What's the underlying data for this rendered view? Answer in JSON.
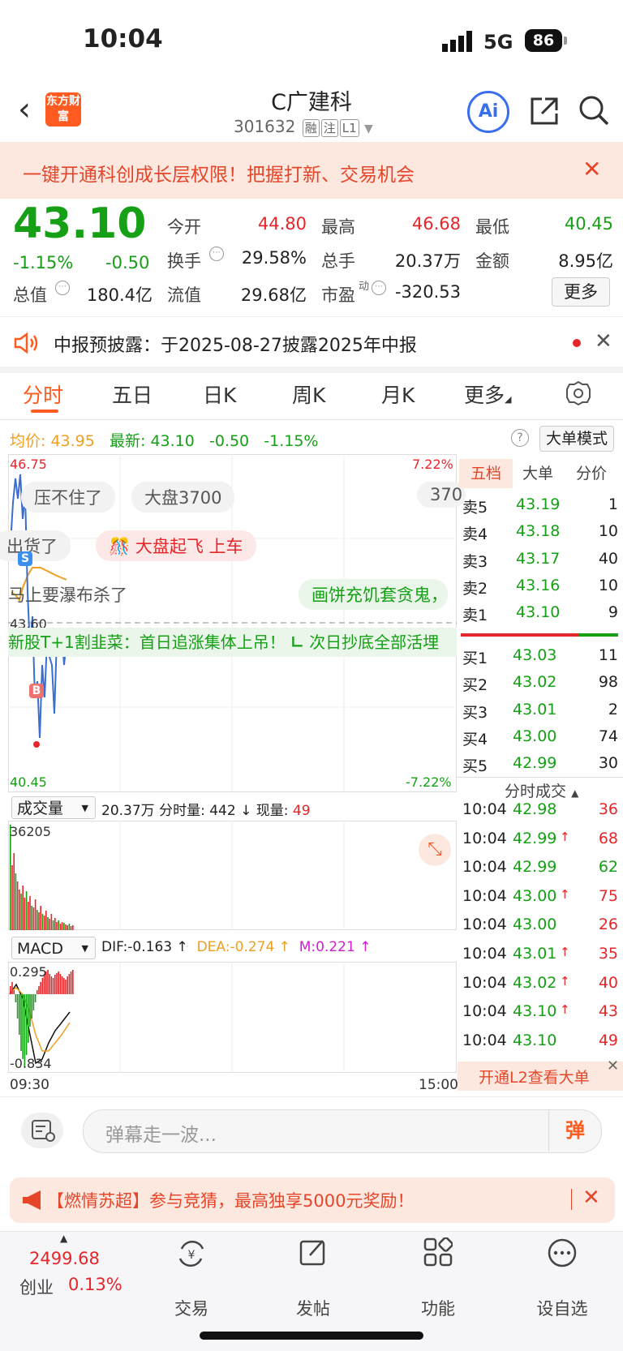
{
  "status": {
    "time": "10:04",
    "network": "5G",
    "battery": "86"
  },
  "header": {
    "title": "C广建科",
    "code": "301632",
    "tags": [
      "融",
      "注",
      "L1"
    ],
    "logo_text": "东方财富",
    "ai_label": "Ai"
  },
  "promo": {
    "text": "一键开通科创成长层权限！把握打新、交易机会"
  },
  "quote": {
    "price": "43.10",
    "pct": "-1.15%",
    "chg": "-0.50",
    "open_label": "今开",
    "open": "44.80",
    "high_label": "最高",
    "high": "46.68",
    "low_label": "最低",
    "low": "40.45",
    "turnover_label": "换手",
    "turnover": "29.58%",
    "volume_label": "总手",
    "volume": "20.37万",
    "amount_label": "金额",
    "amount": "8.95亿",
    "mktcap_label": "总值",
    "mktcap": "180.4亿",
    "float_label": "流值",
    "float": "29.68亿",
    "pe_label": "市盈",
    "pe_sup": "动",
    "pe": "-320.53",
    "more_label": "更多"
  },
  "notice": {
    "text": "中报预披露：于2025-08-27披露2025年中报"
  },
  "tabs": [
    "分时",
    "五日",
    "日K",
    "周K",
    "月K",
    "更多"
  ],
  "info": {
    "avg_label": "均价:",
    "avg": "43.95",
    "latest_label": "最新:",
    "latest": "43.10",
    "chg": "-0.50",
    "pct": "-1.15%",
    "big_mode": "大单模式"
  },
  "chart": {
    "y_max": "46.75",
    "y_min": "40.45",
    "pct_max": "7.22%",
    "pct_min": "-7.22%",
    "ref_price": "43.60",
    "time_start": "09:30",
    "time_end": "15:00",
    "bubbles": [
      "压不住了",
      "大盘3700",
      "370",
      "出货了",
      "大盘起飞 上车",
      "马上要瀑布杀了",
      "画饼充饥套贪鬼，",
      "新股T+1割韭菜：首日追涨集体上吊！",
      "次日抄底全部活埋"
    ],
    "markers": {
      "sell": "S",
      "buy": "B"
    }
  },
  "orderbook": {
    "tabs": [
      "五档",
      "大单",
      "分价"
    ],
    "asks": [
      {
        "label": "卖5",
        "price": "43.19",
        "vol": "1"
      },
      {
        "label": "卖4",
        "price": "43.18",
        "vol": "10"
      },
      {
        "label": "卖3",
        "price": "43.17",
        "vol": "40"
      },
      {
        "label": "卖2",
        "price": "43.16",
        "vol": "10"
      },
      {
        "label": "卖1",
        "price": "43.10",
        "vol": "9"
      }
    ],
    "bids": [
      {
        "label": "买1",
        "price": "43.03",
        "vol": "11"
      },
      {
        "label": "买2",
        "price": "43.02",
        "vol": "98"
      },
      {
        "label": "买3",
        "price": "43.01",
        "vol": "2"
      },
      {
        "label": "买4",
        "price": "43.00",
        "vol": "74"
      },
      {
        "label": "买5",
        "price": "42.99",
        "vol": "30"
      }
    ]
  },
  "ticks": {
    "title": "分时成交",
    "rows": [
      {
        "time": "10:04",
        "price": "42.98",
        "arrow": "",
        "vol": "36",
        "color": "red"
      },
      {
        "time": "10:04",
        "price": "42.99",
        "arrow": "↑",
        "vol": "68",
        "color": "red"
      },
      {
        "time": "10:04",
        "price": "42.99",
        "arrow": "",
        "vol": "62",
        "color": "green"
      },
      {
        "time": "10:04",
        "price": "43.00",
        "arrow": "↑",
        "vol": "75",
        "color": "red"
      },
      {
        "time": "10:04",
        "price": "43.00",
        "arrow": "",
        "vol": "26",
        "color": "red"
      },
      {
        "time": "10:04",
        "price": "43.01",
        "arrow": "↑",
        "vol": "35",
        "color": "red"
      },
      {
        "time": "10:04",
        "price": "43.02",
        "arrow": "↑",
        "vol": "40",
        "color": "red"
      },
      {
        "time": "10:04",
        "price": "43.10",
        "arrow": "↑",
        "vol": "43",
        "color": "red"
      },
      {
        "time": "10:04",
        "price": "43.10",
        "arrow": "",
        "vol": "49",
        "color": "red"
      }
    ],
    "l2": "开通L2查看大单"
  },
  "volume": {
    "dropdown": "成交量",
    "total": "20.37万",
    "min_label": "分时量:",
    "min_vol": "442",
    "min_arrow": "↓",
    "now_label": "现量:",
    "now": "49",
    "max": "36205"
  },
  "macd": {
    "dropdown": "MACD",
    "dif": "DIF:-0.163",
    "dea": "DEA:-0.274",
    "m": "M:0.221",
    "top": "0.295",
    "bottom": "-0.834"
  },
  "comment": {
    "placeholder": "弹幕走一波...",
    "btn": "弹"
  },
  "ad": {
    "text": "【燃情苏超】参与竞猜，最高独享5000元奖励！"
  },
  "tabbar": {
    "index_value": "2499.68",
    "index_name": "创业",
    "index_pct": "0.13%",
    "items": [
      "交易",
      "发帖",
      "功能",
      "设自选"
    ]
  }
}
